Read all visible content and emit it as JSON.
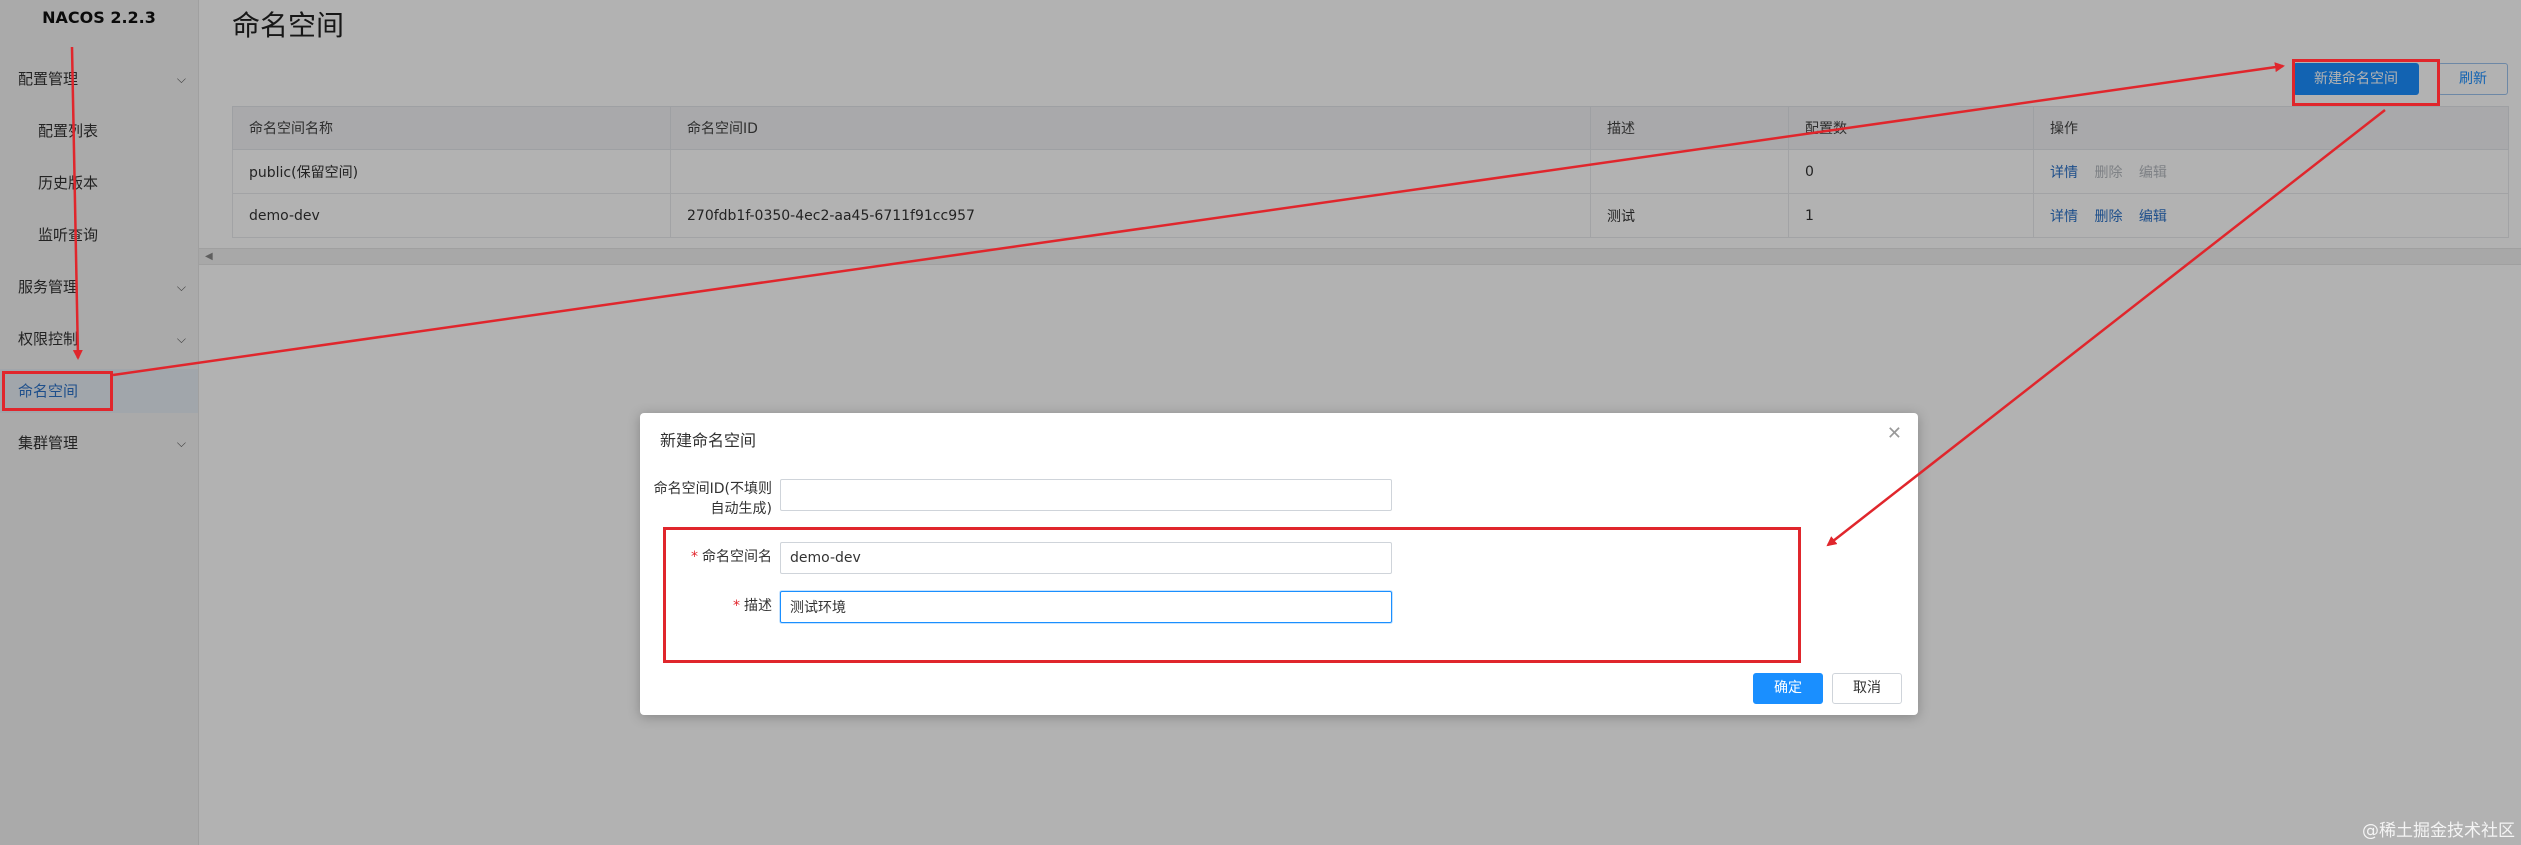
{
  "sidebar": {
    "brand": "NACOS 2.2.3",
    "items": [
      {
        "label": "配置管理"
      },
      {
        "label": "配置列表"
      },
      {
        "label": "历史版本"
      },
      {
        "label": "监听查询"
      },
      {
        "label": "服务管理"
      },
      {
        "label": "权限控制"
      },
      {
        "label": "命名空间"
      },
      {
        "label": "集群管理"
      }
    ]
  },
  "main": {
    "title": "命名空间",
    "create_button": "新建命名空间",
    "refresh_button": "刷新",
    "table": {
      "columns": [
        "命名空间名称",
        "命名空间ID",
        "描述",
        "配置数",
        "操作"
      ],
      "rows": [
        {
          "name": "public(保留空间)",
          "id": "",
          "desc": "",
          "count": "0",
          "ops": [
            "详情",
            "删除",
            "编辑"
          ]
        },
        {
          "name": "demo-dev",
          "id": "270fdb1f-0350-4ec2-aa45-6711f91cc957",
          "desc": "测试",
          "count": "1",
          "ops": [
            "详情",
            "删除",
            "编辑"
          ]
        }
      ]
    }
  },
  "dialog": {
    "title": "新建命名空间",
    "close_icon": "close-icon",
    "fields": [
      {
        "label": "命名空间ID(不填则自动生成)",
        "value": ""
      },
      {
        "label": "命名空间名",
        "value": "demo-dev"
      },
      {
        "label": "描述",
        "value": "测试环境"
      }
    ],
    "ok_button": "确定",
    "cancel_button": "取消"
  },
  "colors": {
    "accent": "#1a8fff",
    "annotation": "#e0262c",
    "link": "#2b72c8"
  },
  "watermark": "@稀土掘金技术社区"
}
